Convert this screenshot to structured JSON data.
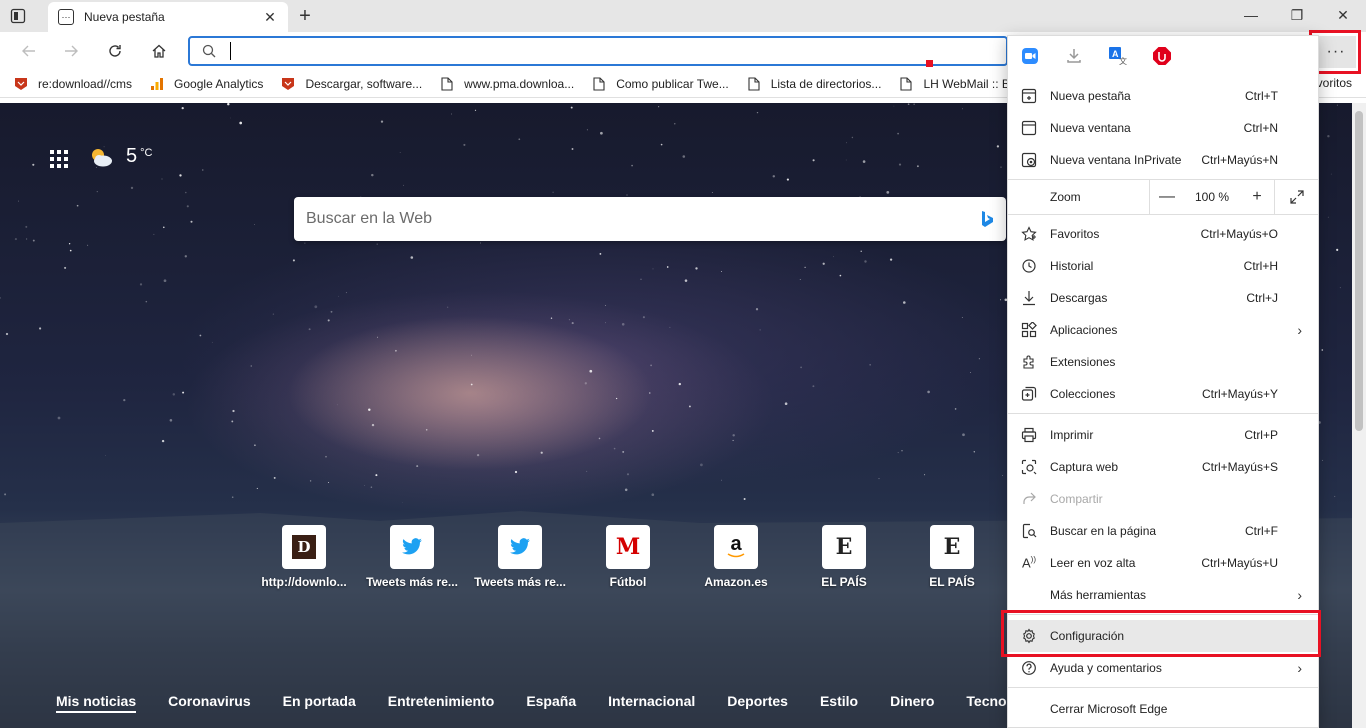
{
  "tab": {
    "title": "Nueva pestaña",
    "close": "✕",
    "new": "+"
  },
  "window": {
    "minimize": "—",
    "maximize": "❐",
    "close": "✕"
  },
  "bookmarks": [
    {
      "label": "re:download//cms",
      "icon": "shield-icon"
    },
    {
      "label": "Google Analytics",
      "icon": "analytics-icon"
    },
    {
      "label": "Descargar, software...",
      "icon": "shield-icon"
    },
    {
      "label": "www.pma.downloa...",
      "icon": "page-icon"
    },
    {
      "label": "Como publicar Twe...",
      "icon": "page-icon"
    },
    {
      "label": "Lista de directorios...",
      "icon": "page-icon"
    },
    {
      "label": "LH WebMail :: Bi",
      "icon": "page-icon"
    }
  ],
  "bookmarks_overflow": "voritos",
  "weather": {
    "temp": "5",
    "unit": "°C"
  },
  "websearch": {
    "placeholder": "Buscar en la Web"
  },
  "tiles": [
    {
      "label": "http://downlo...",
      "icon": "D"
    },
    {
      "label": "Tweets más re...",
      "icon": "twitter"
    },
    {
      "label": "Tweets más re...",
      "icon": "twitter"
    },
    {
      "label": "Fútbol",
      "icon": "M"
    },
    {
      "label": "Amazon.es",
      "icon": "a"
    },
    {
      "label": "EL PAÍS",
      "icon": "E"
    },
    {
      "label": "EL PAÍS",
      "icon": "E"
    }
  ],
  "news": [
    "Mis noticias",
    "Coronavirus",
    "En portada",
    "Entretenimiento",
    "España",
    "Internacional",
    "Deportes",
    "Estilo",
    "Dinero",
    "Tecnología"
  ],
  "menu": {
    "items1": [
      {
        "label": "Nueva pestaña",
        "shortcut": "Ctrl+T"
      },
      {
        "label": "Nueva ventana",
        "shortcut": "Ctrl+N"
      },
      {
        "label": "Nueva ventana InPrivate",
        "shortcut": "Ctrl+Mayús+N"
      }
    ],
    "zoom": {
      "label": "Zoom",
      "value": "100 %",
      "minus": "—",
      "plus": "+"
    },
    "items2": [
      {
        "label": "Favoritos",
        "shortcut": "Ctrl+Mayús+O"
      },
      {
        "label": "Historial",
        "shortcut": "Ctrl+H"
      },
      {
        "label": "Descargas",
        "shortcut": "Ctrl+J"
      },
      {
        "label": "Aplicaciones",
        "shortcut": ""
      },
      {
        "label": "Extensiones",
        "shortcut": ""
      },
      {
        "label": "Colecciones",
        "shortcut": "Ctrl+Mayús+Y"
      }
    ],
    "items3": [
      {
        "label": "Imprimir",
        "shortcut": "Ctrl+P"
      },
      {
        "label": "Captura web",
        "shortcut": "Ctrl+Mayús+S"
      },
      {
        "label": "Compartir",
        "shortcut": ""
      },
      {
        "label": "Buscar en la página",
        "shortcut": "Ctrl+F"
      },
      {
        "label": "Leer en voz alta",
        "shortcut": "Ctrl+Mayús+U"
      },
      {
        "label": "Más herramientas",
        "shortcut": ""
      }
    ],
    "items4": [
      {
        "label": "Configuración",
        "shortcut": ""
      },
      {
        "label": "Ayuda y comentarios",
        "shortcut": ""
      }
    ],
    "close": {
      "label": "Cerrar Microsoft Edge"
    }
  },
  "more_button": "···",
  "colors": {
    "accent": "#2b78d6",
    "highlight_box": "#e81123"
  }
}
